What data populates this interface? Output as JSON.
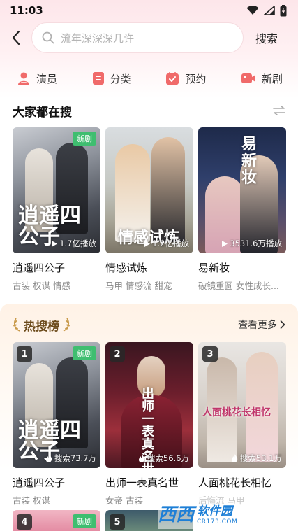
{
  "status_bar": {
    "time": "11:03"
  },
  "search": {
    "placeholder": "流年深深深几许",
    "action_label": "搜索"
  },
  "categories": [
    {
      "label": "演员",
      "icon": "person-icon",
      "color": "#f06a6a"
    },
    {
      "label": "分类",
      "icon": "category-icon",
      "color": "#f06a6a"
    },
    {
      "label": "预约",
      "icon": "calendar-check-icon",
      "color": "#f06a6a"
    },
    {
      "label": "新剧",
      "icon": "video-icon",
      "color": "#f06a6a"
    }
  ],
  "popular": {
    "title": "大家都在搜",
    "cards": [
      {
        "title": "逍遥四公子",
        "tags": "古装 权谋 情感",
        "plays": "1.7亿播放",
        "badge": "新剧",
        "calligraphy": "逍遥四公子"
      },
      {
        "title": "情感试炼",
        "tags": "马甲 情感流 甜宠",
        "plays": "1.2亿播放",
        "badge": "",
        "calligraphy": "情感试炼"
      },
      {
        "title": "易新妆",
        "tags": "破镜重圆 女性成长...",
        "plays": "3531.6万播放",
        "badge": "",
        "calligraphy": "易新妆"
      }
    ]
  },
  "hot": {
    "title": "热搜榜",
    "see_more": "查看更多",
    "cards": [
      {
        "rank": "1",
        "title": "逍遥四公子",
        "tags": "古装 权谋",
        "searches": "搜索73.7万",
        "badge": "新剧",
        "calligraphy": "逍遥四公子"
      },
      {
        "rank": "2",
        "title": "出师一表真名世",
        "tags": "女帝 古装",
        "searches": "搜索56.6万",
        "badge": "",
        "calligraphy": "出师一表真名世"
      },
      {
        "rank": "3",
        "title": "人面桃花长相忆",
        "tags": "后悔流 马甲",
        "searches": "搜索53.1万",
        "badge": "",
        "calligraphy": "人面桃花长相忆"
      }
    ],
    "next_row": [
      {
        "rank": "4",
        "badge": "新剧"
      },
      {
        "rank": "5",
        "badge": ""
      }
    ]
  },
  "watermark": {
    "main": "软件园",
    "sub": "CR173.COM",
    "logo": "西西"
  },
  "colors": {
    "accent_green": "#3fbe70",
    "hot_gold": "#b98a3e",
    "pink": "#f06a6a"
  }
}
